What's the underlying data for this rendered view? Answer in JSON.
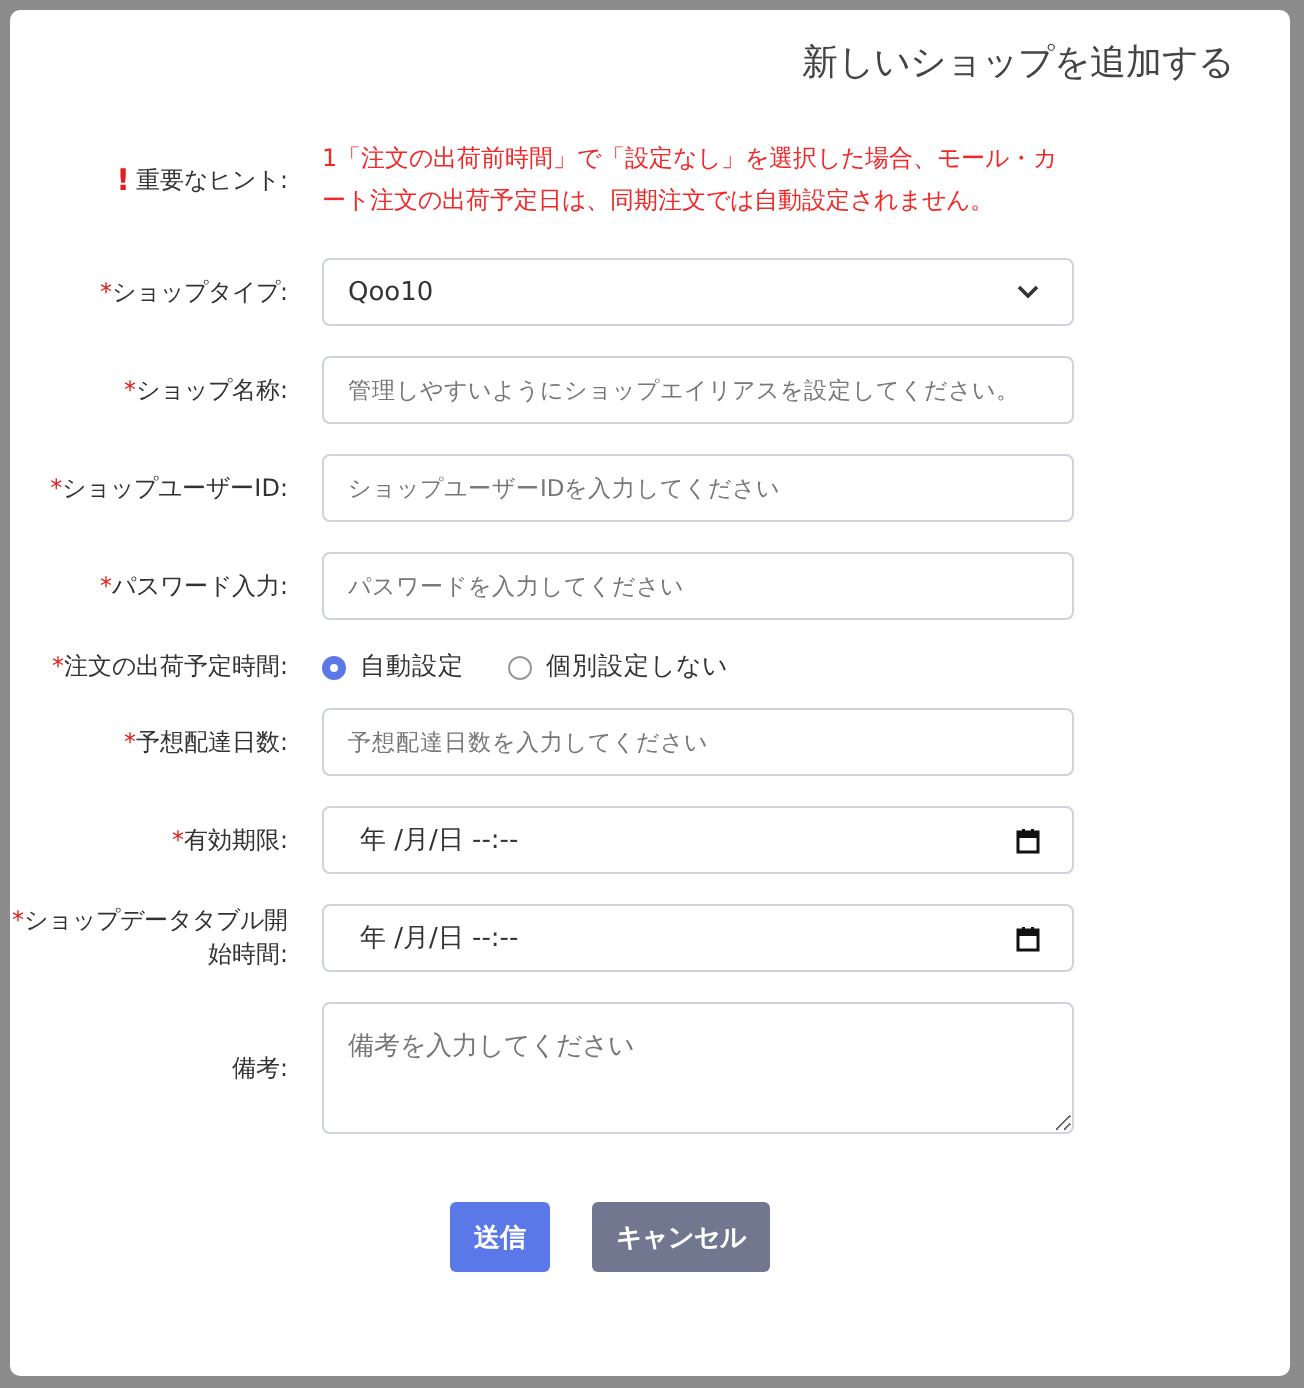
{
  "dialog": {
    "title": "新しいショップを追加する",
    "hint": {
      "mark": "!",
      "label": "重要なヒント:",
      "text": "1「注文の出荷前時間」で「設定なし」を選択した場合、モール・カート注文の出荷予定日は、同期注文では自動設定されません。"
    },
    "fields": [
      {
        "kind": "select",
        "required_mark": "*",
        "label": "ショップタイプ:",
        "value": "Qoo10"
      },
      {
        "kind": "text",
        "required_mark": "*",
        "label": "ショップ名称:",
        "placeholder": "管理しやすいようにショップエイリアスを設定してください。"
      },
      {
        "kind": "text",
        "required_mark": "*",
        "label": "ショップユーザーID:",
        "placeholder": "ショップユーザーIDを入力してください"
      },
      {
        "kind": "text",
        "required_mark": "*",
        "label": "パスワード入力:",
        "placeholder": "パスワードを入力してください"
      },
      {
        "kind": "radio",
        "required_mark": "*",
        "label": "注文の出荷予定時間:",
        "options": [
          {
            "label": "自動設定",
            "selected": true
          },
          {
            "label": "個別設定しない",
            "selected": false
          }
        ]
      },
      {
        "kind": "text",
        "required_mark": "*",
        "label": "予想配達日数:",
        "placeholder": "予想配達日数を入力してください"
      },
      {
        "kind": "date",
        "required_mark": "*",
        "label": "有効期限:",
        "value": "年 /月/日 --:--"
      },
      {
        "kind": "date",
        "required_mark": "*",
        "label": "ショップデータタブル開始時間:",
        "value": "年 /月/日 --:--"
      },
      {
        "kind": "textarea",
        "label": "備考:",
        "placeholder": "備考を入力してください"
      }
    ],
    "buttons": [
      {
        "label": "送信",
        "kind": "primary"
      },
      {
        "label": "キャンセル",
        "kind": "secondary"
      }
    ]
  }
}
